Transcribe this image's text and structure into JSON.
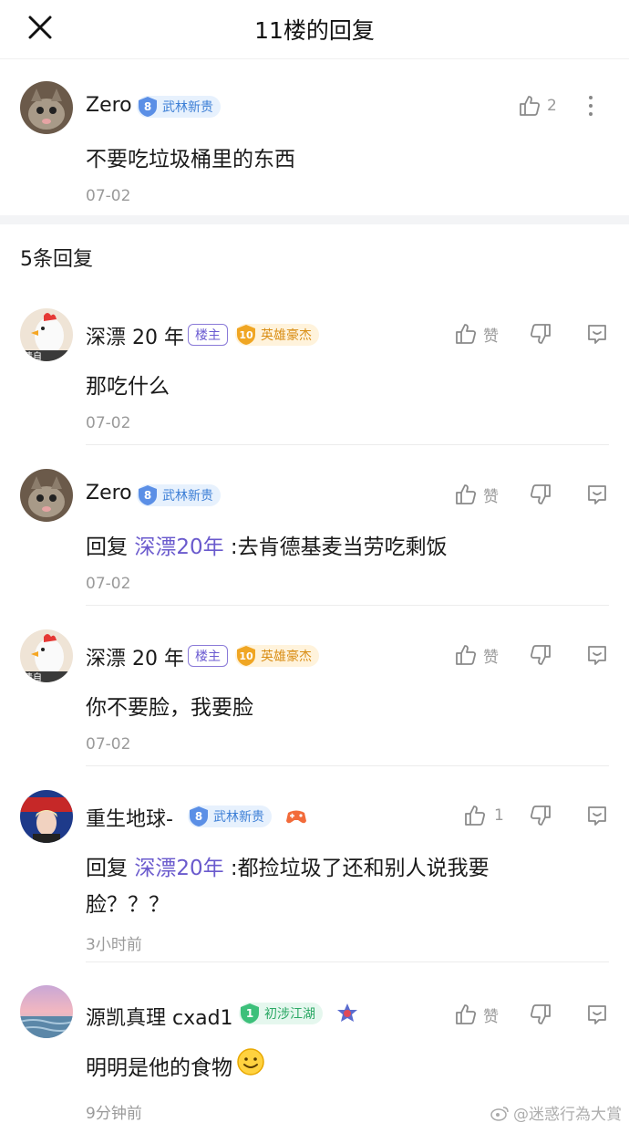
{
  "header": {
    "title": "11楼的回复"
  },
  "post": {
    "username": "Zero",
    "level": "8",
    "level_title": "武林新贵",
    "likes": "2",
    "content": "不要吃垃圾桶里的东西",
    "time": "07-02"
  },
  "reply_count": "5条回复",
  "comments": [
    {
      "username": "深漂 20 年",
      "owner_tag": "楼主",
      "level": "10",
      "level_title": "英雄豪杰",
      "like_label": "赞",
      "reply_prefix": "",
      "reply_to": "",
      "content": "那吃什么",
      "content_line2": "",
      "time": "07-02"
    },
    {
      "username": "Zero",
      "owner_tag": "",
      "level": "8",
      "level_title": "武林新贵",
      "like_label": "赞",
      "reply_prefix": "回复 ",
      "reply_to": "深漂20年",
      "content": " :去肯德基麦当劳吃剩饭",
      "content_line2": "",
      "time": "07-02"
    },
    {
      "username": "深漂 20 年",
      "owner_tag": "楼主",
      "level": "10",
      "level_title": "英雄豪杰",
      "like_label": "赞",
      "reply_prefix": "",
      "reply_to": "",
      "content": "你不要脸，我要脸",
      "content_line2": "",
      "time": "07-02"
    },
    {
      "username": "重生地球-",
      "owner_tag": "",
      "level": "8",
      "level_title": "武林新贵",
      "like_label": "1",
      "reply_prefix": "回复 ",
      "reply_to": "深漂20年",
      "content": " :都捡垃圾了还和别人说我要",
      "content_line2": "脸？？？",
      "time": "3小时前"
    },
    {
      "username": "源凯真理 cxad1",
      "owner_tag": "",
      "level": "1",
      "level_title": "初涉江湖",
      "like_label": "赞",
      "reply_prefix": "",
      "reply_to": "",
      "content": "明明是他的食物",
      "content_line2": "",
      "time": "9分钟前"
    }
  ],
  "watermark": "@迷惑行為大賞",
  "colors": {
    "link_purple": "#6a5acd",
    "badge_blue": "#5b8fe6",
    "badge_gold": "#f0a623",
    "badge_green": "#3cc07a"
  }
}
